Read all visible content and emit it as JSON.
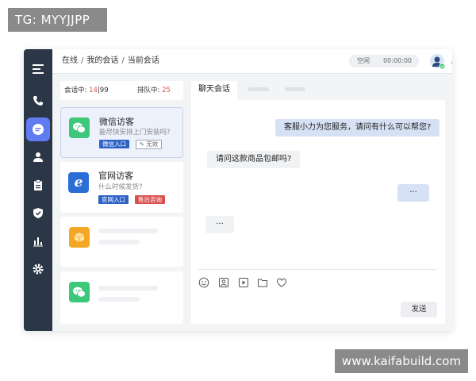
{
  "watermark": {
    "top": "TG: MYYJJPP",
    "bottom": "www.kaifabuild.com"
  },
  "sidebar": {
    "items": [
      {
        "icon": "menu-icon"
      },
      {
        "icon": "phone-icon"
      },
      {
        "icon": "chat-icon",
        "active": true
      },
      {
        "icon": "user-icon"
      },
      {
        "icon": "clipboard-icon"
      },
      {
        "icon": "shield-icon"
      },
      {
        "icon": "bar-chart-icon"
      },
      {
        "icon": "gear-icon"
      }
    ]
  },
  "header": {
    "breadcrumb": [
      "在线",
      "我的会话",
      "当前会话"
    ],
    "separator": "/",
    "status": "空闲",
    "timer": "00:00:00"
  },
  "counters": {
    "in_session_label": "会话中:",
    "in_session_current": "14",
    "in_session_divider": "|",
    "in_session_max": "99",
    "queue_label": "排队中:",
    "queue_count": "25"
  },
  "visitors": [
    {
      "icon": "wechat-icon",
      "title": "微信访客",
      "message": "能尽快安排上门安装吗?",
      "tags": [
        "微信入口",
        "无效"
      ],
      "active": true
    },
    {
      "icon": "ie-browser-icon",
      "title": "官网访客",
      "message": "什么时候发货?",
      "tags": [
        "官网入口",
        "售后咨询"
      ]
    },
    {
      "icon": "box-icon",
      "placeholder": true
    },
    {
      "icon": "wechat-icon",
      "placeholder": true
    }
  ],
  "chat": {
    "tab_label": "聊天会话",
    "messages": [
      {
        "from": "agent",
        "text": "客服小力为您服务，请问有什么可以帮您?"
      },
      {
        "from": "visitor",
        "text": "请问这款商品包邮吗?"
      },
      {
        "from": "agent",
        "text": "···"
      },
      {
        "from": "visitor",
        "text": "···"
      }
    ],
    "toolbar": [
      "emoji-icon",
      "image-icon",
      "video-icon",
      "folder-icon",
      "heart-icon"
    ],
    "send_label": "发送"
  },
  "colors": {
    "sidebar": "#2b3647",
    "accent": "#5f7cf0",
    "alert_red": "#e14b4b",
    "tag_blue": "#2f62c7",
    "tag_red": "#d9514f",
    "wechat_green": "#3cc77a",
    "ie_blue": "#2b6fd6",
    "box_orange": "#f5a623"
  }
}
